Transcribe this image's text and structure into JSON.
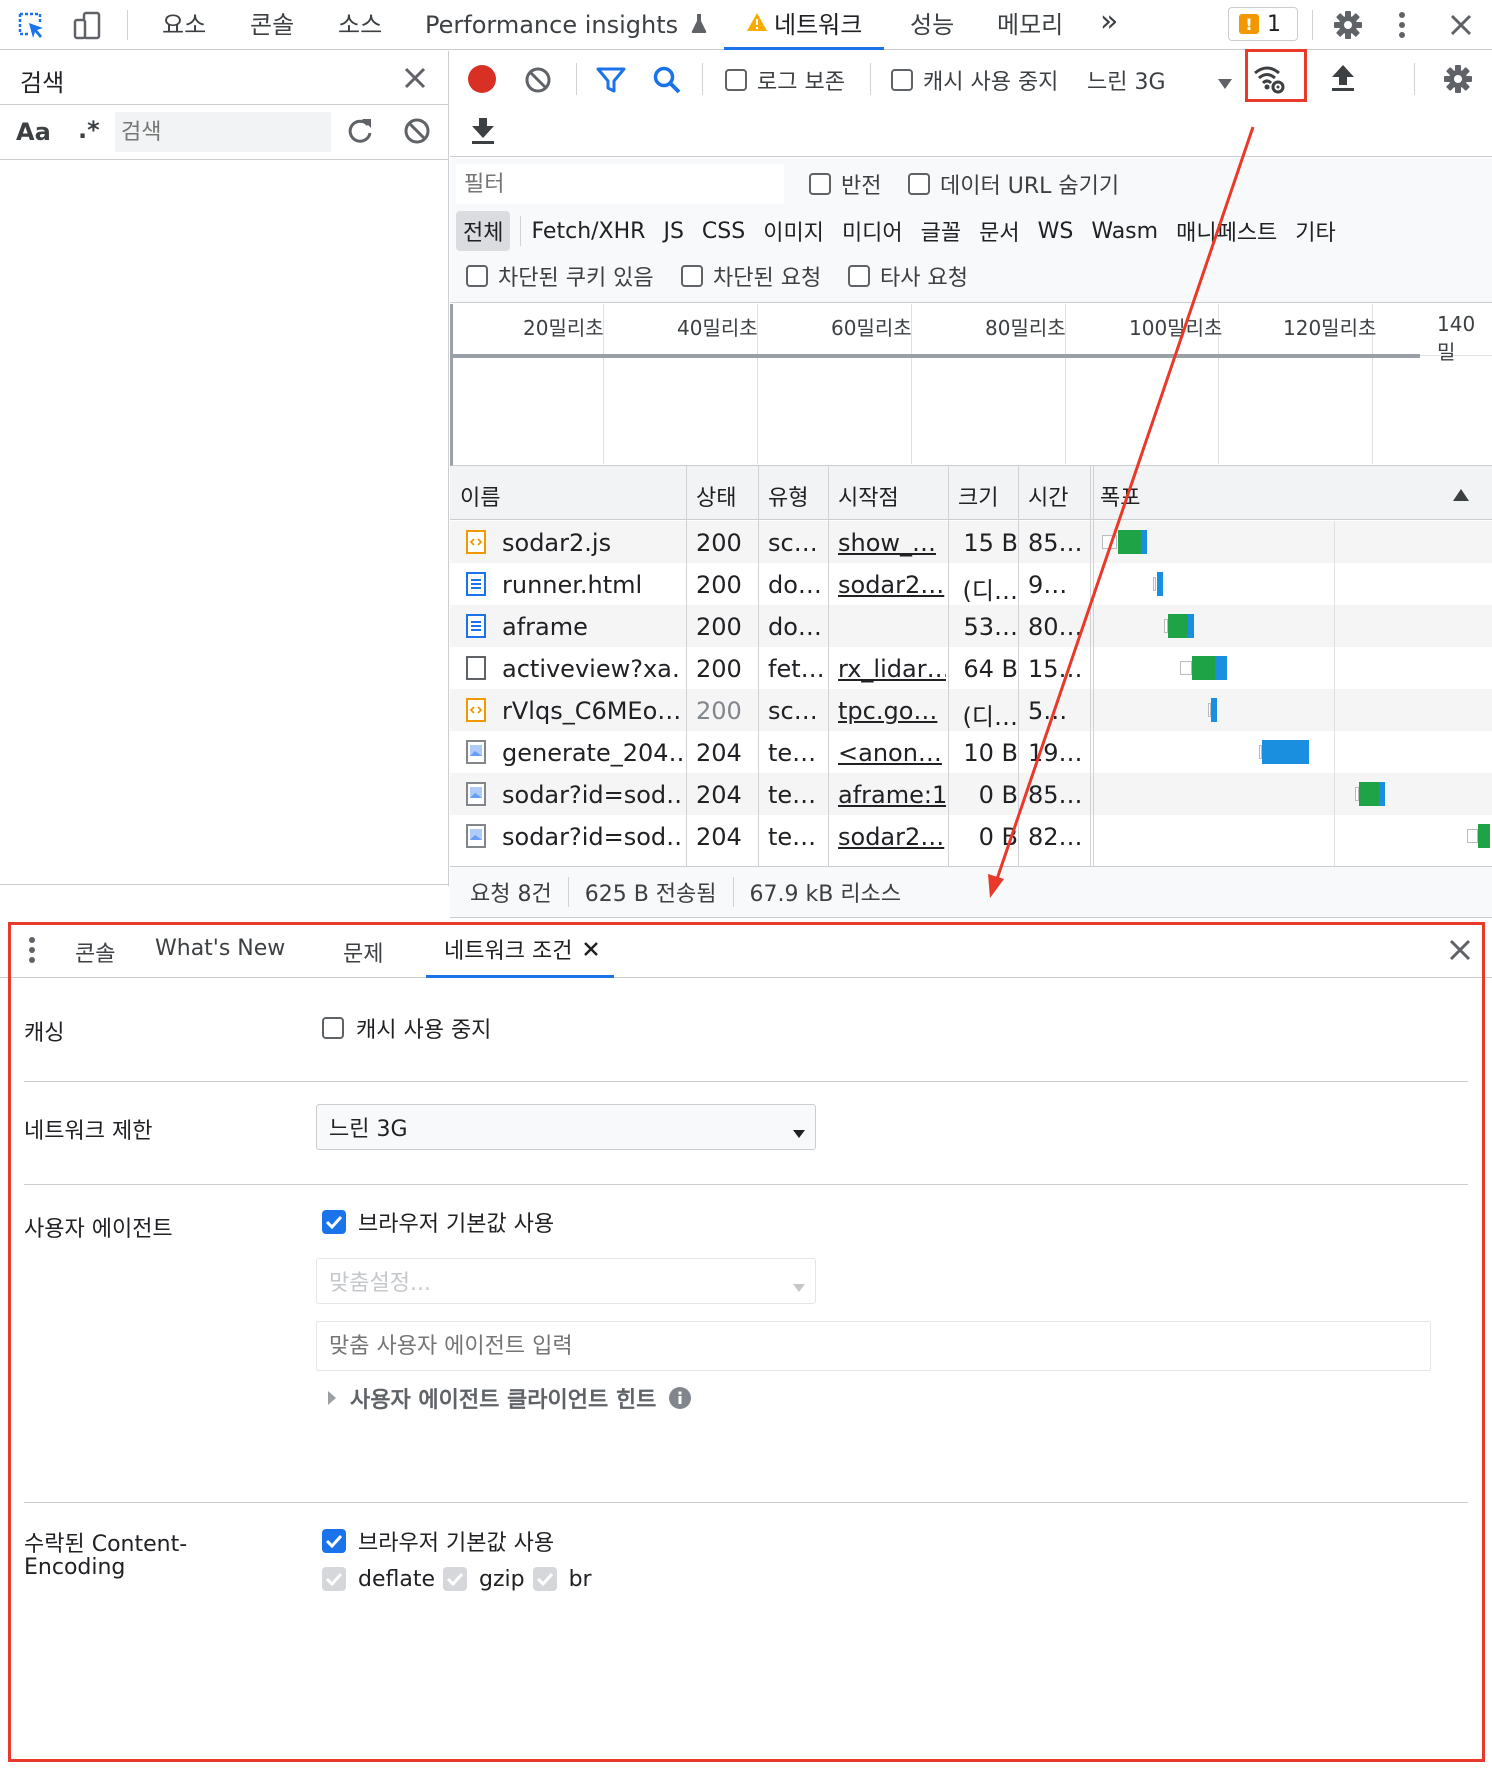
{
  "top_tabs": {
    "elements": "요소",
    "console": "콘솔",
    "sources": "소스",
    "perf_insights": "Performance insights",
    "network": "네트워크",
    "performance": "성능",
    "memory": "메모리",
    "more": "»",
    "issues_count": "1"
  },
  "search_panel": {
    "title": "검색",
    "aa": "Aa",
    "regex": ".*",
    "placeholder": "검색"
  },
  "toolbar": {
    "preserve_log": "로그 보존",
    "disable_cache": "캐시 사용 중지",
    "throttle": "느린 3G"
  },
  "filter": {
    "placeholder": "필터",
    "invert": "반전",
    "hide_data_urls": "데이터 URL 숨기기",
    "types": [
      "전체",
      "Fetch/XHR",
      "JS",
      "CSS",
      "이미지",
      "미디어",
      "글꼴",
      "문서",
      "WS",
      "Wasm",
      "매니페스트",
      "기타"
    ],
    "blocked_cookies": "차단된 쿠키 있음",
    "blocked_requests": "차단된 요청",
    "third_party": "타사 요청"
  },
  "timeline": {
    "ticks": [
      "20밀리초",
      "40밀리초",
      "60밀리초",
      "80밀리초",
      "100밀리초",
      "120밀리초",
      "140밀"
    ]
  },
  "table": {
    "headers": {
      "name": "이름",
      "status": "상태",
      "type": "유형",
      "initiator": "시작점",
      "size": "크기",
      "time": "시간",
      "waterfall": "폭포"
    },
    "rows": [
      {
        "icon": "script-icon",
        "name": "sodar2.js",
        "status": "200",
        "type": "sc…",
        "initiator": "show_…",
        "size": "15 B",
        "time": "85…",
        "faded": false,
        "wf": {
          "wait": 0.04,
          "start": 0.05,
          "green": 0.06,
          "blue": 0.01
        }
      },
      {
        "icon": "document-icon",
        "name": "runner.html",
        "status": "200",
        "type": "do…",
        "initiator": "sodar2…",
        "size": "(디…",
        "time": "9…",
        "faded": false,
        "wf": {
          "wait": 0.01,
          "start": 0.15,
          "green": 0.0,
          "blue": 0.015
        }
      },
      {
        "icon": "document-icon",
        "name": "aframe",
        "status": "200",
        "type": "do…",
        "initiator": "",
        "size": "53…",
        "time": "80…",
        "faded": false,
        "wf": {
          "wait": 0.01,
          "start": 0.18,
          "green": 0.05,
          "blue": 0.01
        }
      },
      {
        "icon": "blank-file-icon",
        "name": "activeview?xa…",
        "status": "200",
        "type": "fet…",
        "initiator": "rx_lidar…",
        "size": "64 B",
        "time": "15…",
        "faded": false,
        "wf": {
          "wait": 0.03,
          "start": 0.24,
          "green": 0.06,
          "blue": 0.03
        }
      },
      {
        "icon": "script-icon",
        "name": "rVlqs_C6MEo…",
        "status": "200",
        "type": "sc…",
        "initiator": "tpc.go…",
        "size": "(디…",
        "time": "5…",
        "faded": true,
        "wf": {
          "wait": 0.005,
          "start": 0.29,
          "green": 0.0,
          "blue": 0.01
        }
      },
      {
        "icon": "image-icon",
        "name": "generate_204…",
        "status": "204",
        "type": "te…",
        "initiator": "<anon…",
        "size": "10 B",
        "time": "19…",
        "faded": false,
        "wf": {
          "wait": 0.005,
          "start": 0.42,
          "green": 0.0,
          "blue": 0.12
        }
      },
      {
        "icon": "image-icon",
        "name": "sodar?id=sod…",
        "status": "204",
        "type": "te…",
        "initiator": "aframe:1",
        "size": "0 B",
        "time": "85…",
        "faded": false,
        "wf": {
          "wait": 0.01,
          "start": 0.67,
          "green": 0.05,
          "blue": 0.01
        }
      },
      {
        "icon": "image-icon",
        "name": "sodar?id=sod…",
        "status": "204",
        "type": "te…",
        "initiator": "sodar2…",
        "size": "0 B",
        "time": "82…",
        "faded": false,
        "wf": {
          "wait": 0.03,
          "start": 0.975,
          "green": 0.03,
          "blue": 0.0
        }
      }
    ]
  },
  "status_bar": {
    "requests": "요청 8건",
    "transferred": "625 B 전송됨",
    "resources": "67.9 kB 리소스"
  },
  "drawer": {
    "tabs": [
      "콘솔",
      "What's New",
      "문제",
      "네트워크 조건"
    ],
    "caching_label": "캐싱",
    "caching_option": "캐시 사용 중지",
    "throttling_label": "네트워크 제한",
    "throttling_value": "느린 3G",
    "ua_label": "사용자 에이전트",
    "ua_default": "브라우저 기본값 사용",
    "ua_custom_placeholder": "맞춤설정...",
    "ua_input_placeholder": "맞춤 사용자 에이전트 입력",
    "ua_hints": "사용자 에이전트 클라이언트 힌트",
    "encoding_label_1": "수락된 Content-",
    "encoding_label_2": "Encoding",
    "encoding_default": "브라우저 기본값 사용",
    "encodings": [
      "deflate",
      "gzip",
      "br"
    ]
  },
  "colors": {
    "accent": "#1a73e8",
    "record": "#d93025",
    "annotation": "#e8392b",
    "wf_green": "#1ea446",
    "wf_blue": "#1a8fe0"
  }
}
